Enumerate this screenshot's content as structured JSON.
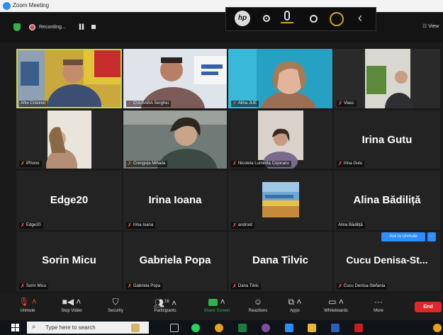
{
  "window": {
    "title": "Zoom Meeting"
  },
  "recording": {
    "label": "Recording..."
  },
  "view_label": "View",
  "hp_toolbar": {
    "logo": "hp"
  },
  "participants": [
    {
      "label": "Afloi Cristinel"
    },
    {
      "label": "CULBABA Serghei"
    },
    {
      "label": "Alina JUE"
    },
    {
      "label": "Vlasc"
    },
    {
      "label": "iPhone"
    },
    {
      "label": "Crenguța Mihaila"
    },
    {
      "label": "Nicoleta Luminita Cojocaru"
    },
    {
      "name": "Irina Gutu",
      "label": "Irina Gutu"
    },
    {
      "name": "Edge20",
      "label": "Edge20"
    },
    {
      "name": "Irina Ioana",
      "label": "Irina Ioana"
    },
    {
      "label": "android"
    },
    {
      "name": "Alina Bădiliță",
      "label": "Alina Bădiliță"
    },
    {
      "name": "Sorin Micu",
      "label": "Sorin Micu"
    },
    {
      "name": "Gabriela Popa",
      "label": "Gabriela Popa"
    },
    {
      "name": "Dana Tilvic",
      "label": "Dana Tilvic"
    },
    {
      "name": "Cucu  Denisa-St...",
      "label": "Cucu Denisa-Stefania"
    }
  ],
  "ask_unmute": "Ask to Unmute",
  "more_dots": "···",
  "toolbar": {
    "unmute": "Unmute",
    "stop_video": "Stop Video",
    "security": "Security",
    "participants": "Participants",
    "participants_count": "16",
    "share_screen": "Share Screen",
    "reactions": "Reactions",
    "apps": "Apps",
    "whiteboards": "Whiteboards",
    "more": "More",
    "end": "End"
  },
  "taskbar": {
    "search_placeholder": "Type here to search"
  },
  "colors": {
    "accent": "#2d8cff",
    "active_speaker": "#c4d63a",
    "end": "#e02828",
    "green": "#2fb24c"
  }
}
